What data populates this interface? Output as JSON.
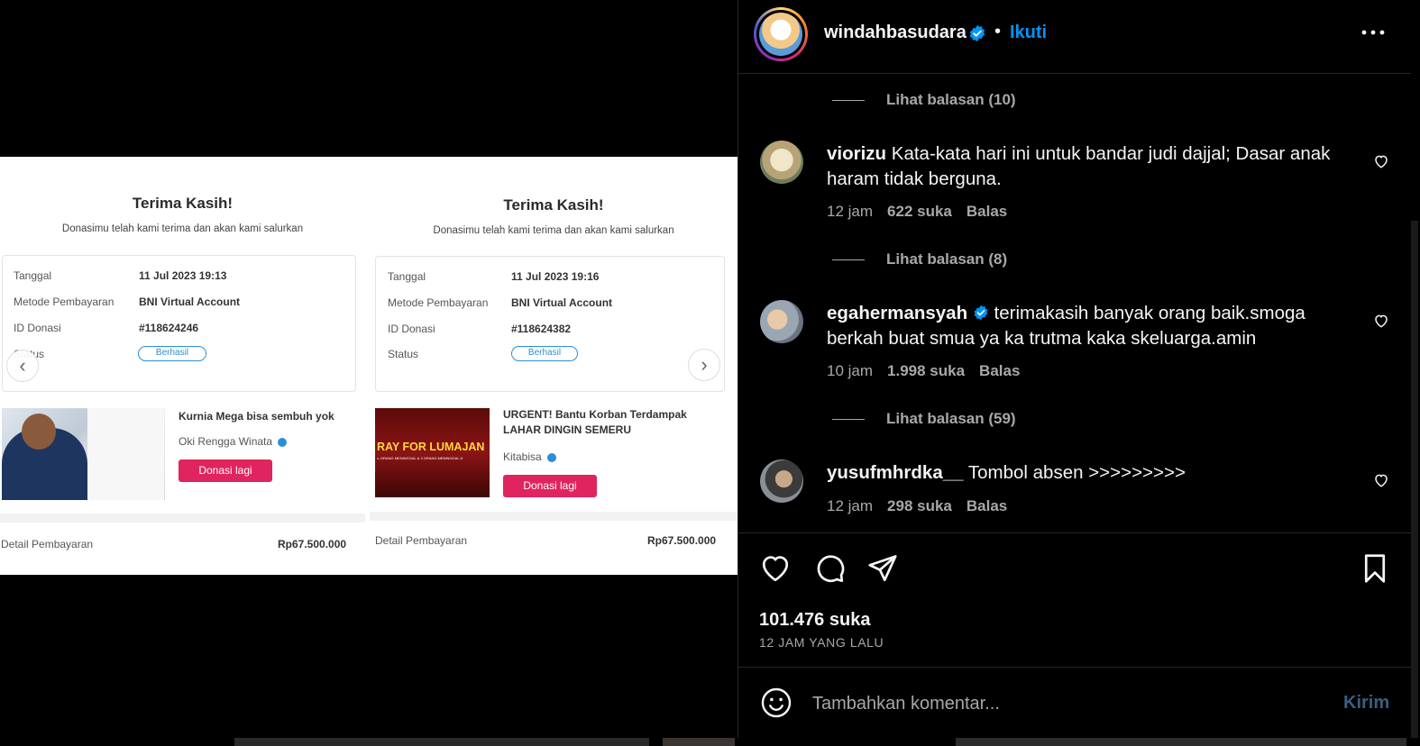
{
  "post": {
    "author": "windahbasudara",
    "follow_label": "Ikuti",
    "likes": "101.476 suka",
    "time_ago": "12 JAM YANG LALU",
    "comment_placeholder": "Tambahkan komentar...",
    "send_label": "Kirim"
  },
  "receipts": [
    {
      "title": "Terima Kasih!",
      "subtitle": "Donasimu telah kami terima dan akan kami salurkan",
      "rows": [
        {
          "label": "Tanggal",
          "value": "11 Jul 2023 19:13"
        },
        {
          "label": "Metode Pembayaran",
          "value": "BNI Virtual Account"
        },
        {
          "label": "ID Donasi",
          "value": "#118624246"
        },
        {
          "label": "Status",
          "value": "Berhasil"
        }
      ],
      "campaign_title": "Kurnia Mega bisa sembuh yok",
      "campaign_org": "Oki Rengga Winata",
      "button": "Donasi lagi",
      "detail_label": "Detail Pembayaran",
      "detail_value": "Rp67.500.000"
    },
    {
      "title": "Terima Kasih!",
      "subtitle": "Donasimu telah kami terima dan akan kami salurkan",
      "rows": [
        {
          "label": "Tanggal",
          "value": "11 Jul 2023 19:16"
        },
        {
          "label": "Metode Pembayaran",
          "value": "BNI Virtual Account"
        },
        {
          "label": "ID Donasi",
          "value": "#118624382"
        },
        {
          "label": "Status",
          "value": "Berhasil"
        }
      ],
      "campaign_title_1": "URGENT! Bantu Korban Terdampak",
      "campaign_title_2": "LAHAR DINGIN SEMERU",
      "campaign_org": "Kitabisa",
      "thumb_banner": "RAY FOR LUMAJAN",
      "thumb_banner_sub": "•• ORANG MENINGGAL & 3 ORANG MENINGGAL D",
      "button": "Donasi lagi",
      "detail_label": "Detail Pembayaran",
      "detail_value": "Rp67.500.000"
    }
  ],
  "comments": [
    {
      "view_replies": "Lihat balasan (10)"
    },
    {
      "user": "viorizu",
      "text": "Kata-kata hari ini untuk bandar judi dajjal; Dasar anak haram tidak berguna.",
      "time": "12 jam",
      "likes": "622 suka",
      "reply": "Balas",
      "view_replies": "Lihat balasan (8)"
    },
    {
      "user": "egahermansyah",
      "text": "terimakasih banyak orang baik.smoga berkah buat smua ya ka trutma kaka skeluarga.amin",
      "time": "10 jam",
      "likes": "1.998 suka",
      "reply": "Balas",
      "view_replies": "Lihat balasan (59)"
    },
    {
      "user": "yusufmhrdka__",
      "text": "Tombol absen >>>>>>>>>",
      "time": "12 jam",
      "likes": "298 suka",
      "reply": "Balas"
    }
  ],
  "colors": {
    "accent": "#0095f6",
    "verified": "#0095f6",
    "donate_button": "#e0245e",
    "muted_text": "#a8a8a8"
  }
}
